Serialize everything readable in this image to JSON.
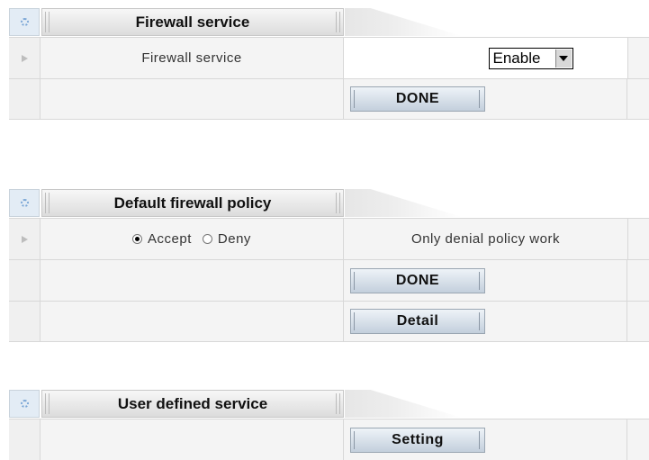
{
  "sections": {
    "firewall": {
      "title": "Firewall service",
      "label": "Firewall service",
      "select_value": "Enable",
      "done_label": "DONE"
    },
    "policy": {
      "title": "Default firewall policy",
      "accept_label": "Accept",
      "deny_label": "Deny",
      "selected": "Accept",
      "note": "Only denial policy work",
      "done_label": "DONE",
      "detail_label": "Detail"
    },
    "user": {
      "title": "User defined service",
      "setting_label": "Setting"
    }
  },
  "icons": {
    "header_icon": "gear-icon",
    "row_icon": "arrow-right-icon",
    "select_icon": "chevron-down-icon"
  },
  "colors": {
    "button_top": "#eef3f8",
    "button_bottom": "#c3cfdc",
    "row_grey": "#f4f4f4"
  }
}
